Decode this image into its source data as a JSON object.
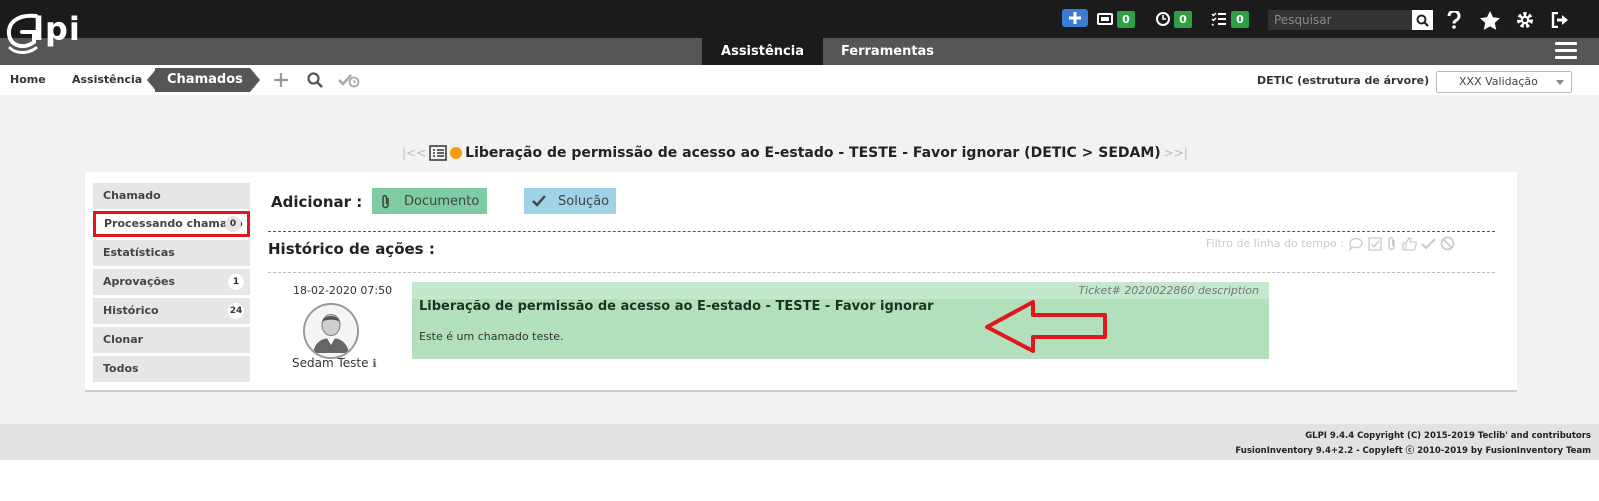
{
  "app": {
    "logo_text": "lpi"
  },
  "topbar": {
    "counters": [
      {
        "icon": "ticket-icon",
        "value": "0"
      },
      {
        "icon": "clock-icon",
        "value": "0"
      },
      {
        "icon": "tasklist-icon",
        "value": "0"
      }
    ],
    "search_placeholder": "Pesquisar",
    "icons": [
      "plus-icon",
      "search-icon",
      "help-icon",
      "star-icon",
      "gear-icon",
      "logout-icon"
    ]
  },
  "menu": {
    "tabs": [
      {
        "label": "Assistência",
        "active": true
      },
      {
        "label": "Ferramentas",
        "active": false
      }
    ]
  },
  "breadcrumb": {
    "items": [
      "Home",
      "Assistência",
      "Chamados"
    ],
    "entity_label": "DETIC (estrutura de árvore)",
    "entity_select": "XXX Validação"
  },
  "ticket": {
    "title": "Liberação de permissão de acesso ao E-estado - TESTE - Favor ignorar (DETIC > SEDAM)",
    "nav_prev": "|<<",
    "nav_next": ">>|",
    "status_color": "#f39c12"
  },
  "sidebar": {
    "items": [
      {
        "label": "Chamado",
        "count": null
      },
      {
        "label": "Processando chamado",
        "count": "0"
      },
      {
        "label": "Estatísticas",
        "count": null
      },
      {
        "label": "Aprovações",
        "count": "1"
      },
      {
        "label": "Histórico",
        "count": "24"
      },
      {
        "label": "Clonar",
        "count": null
      },
      {
        "label": "Todos",
        "count": null
      }
    ]
  },
  "actions": {
    "add_label": "Adicionar :",
    "document_label": "Documento",
    "solution_label": "Solução"
  },
  "history": {
    "title": "Histórico de ações :",
    "filter_label": "Filtro de linha do tempo :",
    "entry": {
      "timestamp": "18-02-2020 07:50",
      "author": "Sedam Teste",
      "ticket_ref": "Ticket# 2020022860 description",
      "title": "Liberação de permissão de acesso ao E-estado - TESTE - Favor ignorar",
      "body": "Este é um chamado teste."
    }
  },
  "footer": {
    "line1": "GLPI 9.4.4 Copyright (C) 2015-2019 Teclib' and contributors",
    "line2": "FusionInventory 9.4+2.2 - Copyleft ⓒ 2010-2019 by FusionInventory Team"
  },
  "colors": {
    "accent_blue": "#3a7bd5",
    "badge_green": "#2ea043",
    "annotation_red": "#e0171f",
    "document_btn": "#7fcba4",
    "solution_btn": "#9fd3e8",
    "note_bg": "#b2e0bc"
  }
}
